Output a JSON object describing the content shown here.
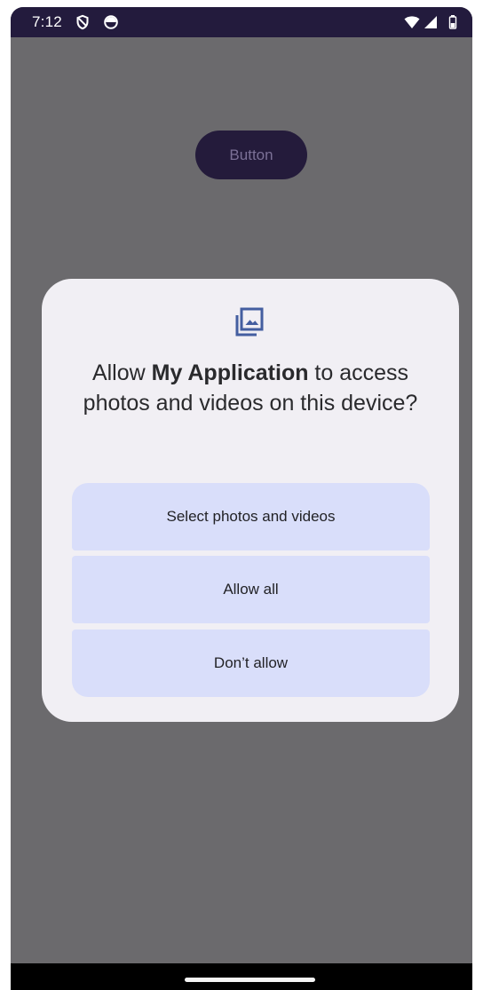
{
  "status_bar": {
    "time": "7:12",
    "icons": [
      "vpn-shield-icon",
      "data-saver-icon",
      "wifi-icon",
      "cellular-signal-icon",
      "battery-icon"
    ]
  },
  "app": {
    "button_label": "Button"
  },
  "permission_dialog": {
    "icon": "photo-library-icon",
    "title_prefix": "Allow ",
    "app_name": "My Application",
    "title_suffix": " to access photos and videos on this device?",
    "options": [
      "Select photos and videos",
      "Allow all",
      "Don’t allow"
    ]
  },
  "colors": {
    "status_bar": "#231b3d",
    "screen_scrim": "#6b6a6d",
    "dialog_background": "#f1eff4",
    "option_background": "#d9defa",
    "accent_icon": "#445ea0",
    "button_background": "#241b3b"
  }
}
